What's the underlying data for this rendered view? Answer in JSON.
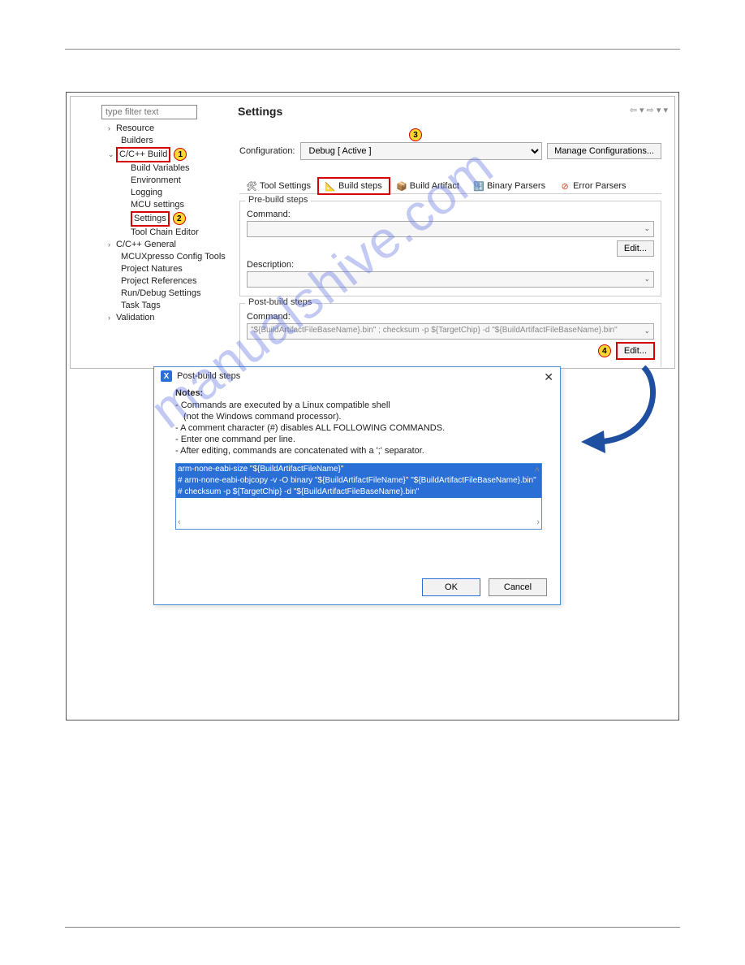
{
  "watermark": "manualshive.com",
  "tree": {
    "filter_placeholder": "type filter text",
    "items": {
      "resource": "Resource",
      "builders": "Builders",
      "cpp_build": "C/C++ Build",
      "build_vars": "Build Variables",
      "environment": "Environment",
      "logging": "Logging",
      "mcu_settings": "MCU settings",
      "settings": "Settings",
      "toolchain": "Tool Chain Editor",
      "cpp_general": "C/C++ General",
      "mcux": "MCUXpresso Config Tools",
      "natures": "Project Natures",
      "refs": "Project References",
      "rundebug": "Run/Debug Settings",
      "tasktags": "Task Tags",
      "validation": "Validation"
    }
  },
  "callouts": {
    "n1": "1",
    "n2": "2",
    "n3": "3",
    "n4": "4"
  },
  "main": {
    "title": "Settings",
    "config_label": "Configuration:",
    "config_value": "Debug  [ Active ]",
    "manage_btn": "Manage Configurations...",
    "tabs": {
      "tool_settings": "Tool Settings",
      "build_steps": "Build steps",
      "build_artifact": "Build Artifact",
      "binary_parsers": "Binary Parsers",
      "error_parsers": "Error Parsers"
    },
    "pre_build": {
      "legend": "Pre-build steps",
      "command_label": "Command:",
      "command_value": "",
      "edit_btn": "Edit...",
      "desc_label": "Description:",
      "desc_value": ""
    },
    "post_build": {
      "legend": "Post-build steps",
      "command_label": "Command:",
      "command_value": "\"${BuildArtifactFileBaseName}.bin\" ; checksum -p ${TargetChip} -d \"${BuildArtifactFileBaseName}.bin\"",
      "edit_btn": "Edit..."
    }
  },
  "dialog": {
    "title": "Post-build steps",
    "notes_heading": "Notes:",
    "note1": "- Commands are executed by a Linux compatible shell",
    "note1b": "(not the Windows command processor).",
    "note2": "- A comment character (#) disables ALL FOLLOWING COMMANDS.",
    "note3": "- Enter one command per line.",
    "note4": "- After editing, commands are concatenated with a ';' separator.",
    "cmd_line1": "arm-none-eabi-size \"${BuildArtifactFileName}\"",
    "cmd_line2": "# arm-none-eabi-objcopy -v -O binary \"${BuildArtifactFileName}\" \"${BuildArtifactFileBaseName}.bin\"",
    "cmd_line3": "# checksum -p ${TargetChip} -d \"${BuildArtifactFileBaseName}.bin\"",
    "ok_btn": "OK",
    "cancel_btn": "Cancel"
  }
}
